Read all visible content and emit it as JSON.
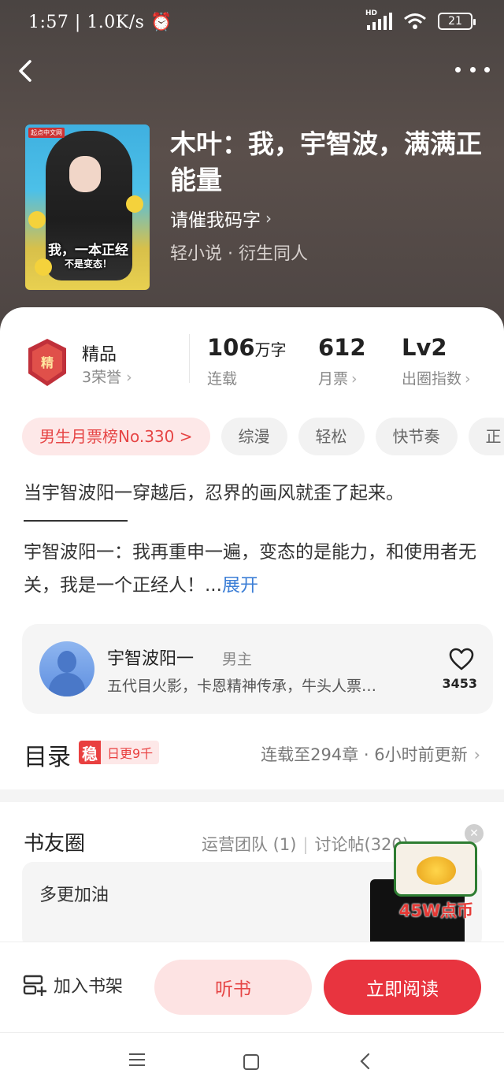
{
  "status_bar": {
    "time": "1:57",
    "net_speed": "1.0K/s",
    "hd": "HD",
    "battery": "21"
  },
  "book": {
    "title": "木叶：我，宇智波，满满正能量",
    "author": "请催我码字",
    "category": "轻小说 · 衍生同人",
    "cover": {
      "publisher_mark": "起点中文网",
      "caption_line1": "我，一本正经",
      "caption_line2": "不是变态！"
    }
  },
  "stats": {
    "honor_title": "精品",
    "honor_sub": "3荣誉",
    "words_num": "106",
    "words_unit": "万字",
    "words_label": "连载",
    "tickets_num": "612",
    "tickets_label": "月票",
    "level_num": "Lv2",
    "level_label": "出圈指数"
  },
  "tags": [
    "男生月票榜No.330 >",
    "综漫",
    "轻松",
    "快节奏",
    "正"
  ],
  "intro": {
    "line1": "当宇智波阳一穿越后，忍界的画风就歪了起来。",
    "para2": "宇智波阳一：我再重申一遍，变态的是能力，和使用者无关，我是一个正经人！...",
    "more": "展开"
  },
  "character": {
    "name": "宇智波阳一",
    "role": "男主",
    "desc": "五代目火影，卡恩精神传承，牛头人票…",
    "likes": "3453"
  },
  "toc": {
    "title": "目录",
    "badge_char": "稳",
    "badge_text": "日更9千",
    "status": "连载至294章 · 6小时前更新"
  },
  "circle": {
    "title": "书友圈",
    "team": "运营团队 (1)",
    "posts": "讨论帖(320)",
    "post_text": "多更加油"
  },
  "promo": {
    "text": "45W点币"
  },
  "actions": {
    "shelf": "加入书架",
    "listen": "听书",
    "read": "立即阅读"
  },
  "colors": {
    "accent": "#e8343f",
    "accent_light": "#fde3e3",
    "link": "#3d7fd6"
  }
}
